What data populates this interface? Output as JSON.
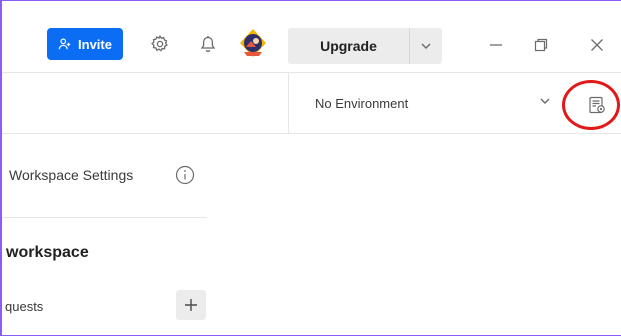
{
  "header": {
    "invite_label": "Invite",
    "upgrade_label": "Upgrade",
    "icons": {
      "invite": "add-user-icon",
      "settings": "gear-icon",
      "notifications": "bell-icon",
      "upgrade_menu": "chevron-down-icon",
      "minimize": "minimize-icon",
      "restore": "restore-icon",
      "close": "close-icon"
    }
  },
  "environment": {
    "selected": "No Environment",
    "quick_look_icon": "environment-quick-look-icon",
    "caret_icon": "chevron-down-icon"
  },
  "sidebar": {
    "workspace_settings_label": "Workspace Settings",
    "info_icon": "info-icon",
    "workspace_title": "workspace",
    "requests_label": "quests",
    "add_icon": "plus-icon"
  },
  "colors": {
    "accent": "#0b6df4",
    "highlight": "#e11919",
    "frame": "#8b5cf6"
  }
}
